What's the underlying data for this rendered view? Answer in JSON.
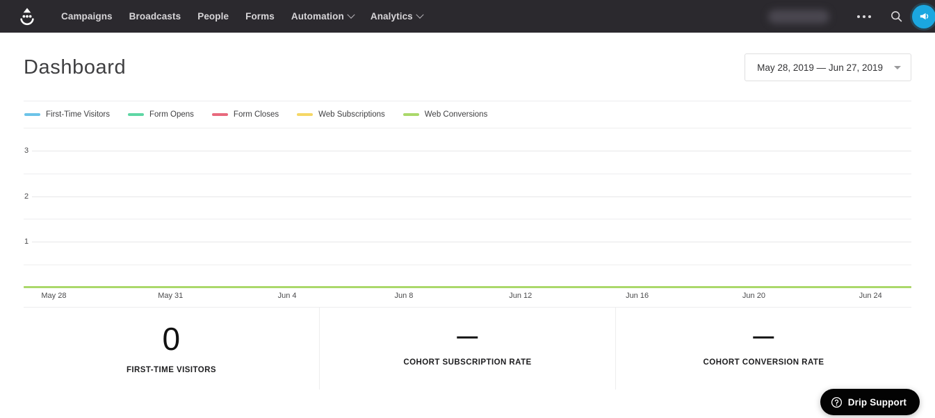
{
  "navbar": {
    "logo_name": "drip-logo-icon",
    "links": [
      {
        "label": "Campaigns",
        "has_caret": false
      },
      {
        "label": "Broadcasts",
        "has_caret": false
      },
      {
        "label": "People",
        "has_caret": false
      },
      {
        "label": "Forms",
        "has_caret": false
      },
      {
        "label": "Automation",
        "has_caret": true
      },
      {
        "label": "Analytics",
        "has_caret": true
      }
    ],
    "account_name": "",
    "more_icon": "ellipsis-icon",
    "search_icon": "search-icon",
    "announcement_icon": "megaphone-icon",
    "accent_color": "#1ba7e0",
    "background_color": "#2b292e"
  },
  "header": {
    "title": "Dashboard",
    "date_range": "May 28, 2019 — Jun 27, 2019"
  },
  "chart_data": {
    "type": "line",
    "title": "",
    "xlabel": "",
    "ylabel": "",
    "ylim": [
      0,
      3.5
    ],
    "yticks": [
      1,
      2,
      3
    ],
    "grid": true,
    "legend_position": "top-left",
    "x": [
      "May 28",
      "May 31",
      "Jun 4",
      "Jun 8",
      "Jun 12",
      "Jun 16",
      "Jun 20",
      "Jun 24"
    ],
    "series": [
      {
        "name": "First-Time Visitors",
        "color": "#6cc3e8",
        "values": [
          0,
          0,
          0,
          0,
          0,
          0,
          0,
          0
        ]
      },
      {
        "name": "Form Opens",
        "color": "#5ed6a4",
        "values": [
          0,
          0,
          0,
          0,
          0,
          0,
          0,
          0
        ]
      },
      {
        "name": "Form Closes",
        "color": "#e8697d",
        "values": [
          0,
          0,
          0,
          0,
          0,
          0,
          0,
          0
        ]
      },
      {
        "name": "Web Subscriptions",
        "color": "#f5d766",
        "values": [
          0,
          0,
          0,
          0,
          0,
          0,
          0,
          0
        ]
      },
      {
        "name": "Web Conversions",
        "color": "#aad86a",
        "values": [
          0,
          0,
          0,
          0,
          0,
          0,
          0,
          0
        ]
      }
    ]
  },
  "stats": [
    {
      "value": "0",
      "label": "FIRST-TIME VISITORS",
      "is_dash": false
    },
    {
      "value": "—",
      "label": "COHORT SUBSCRIPTION RATE",
      "is_dash": true
    },
    {
      "value": "—",
      "label": "COHORT CONVERSION RATE",
      "is_dash": true
    }
  ],
  "support": {
    "label": "Drip Support",
    "icon": "question-circle-icon"
  }
}
